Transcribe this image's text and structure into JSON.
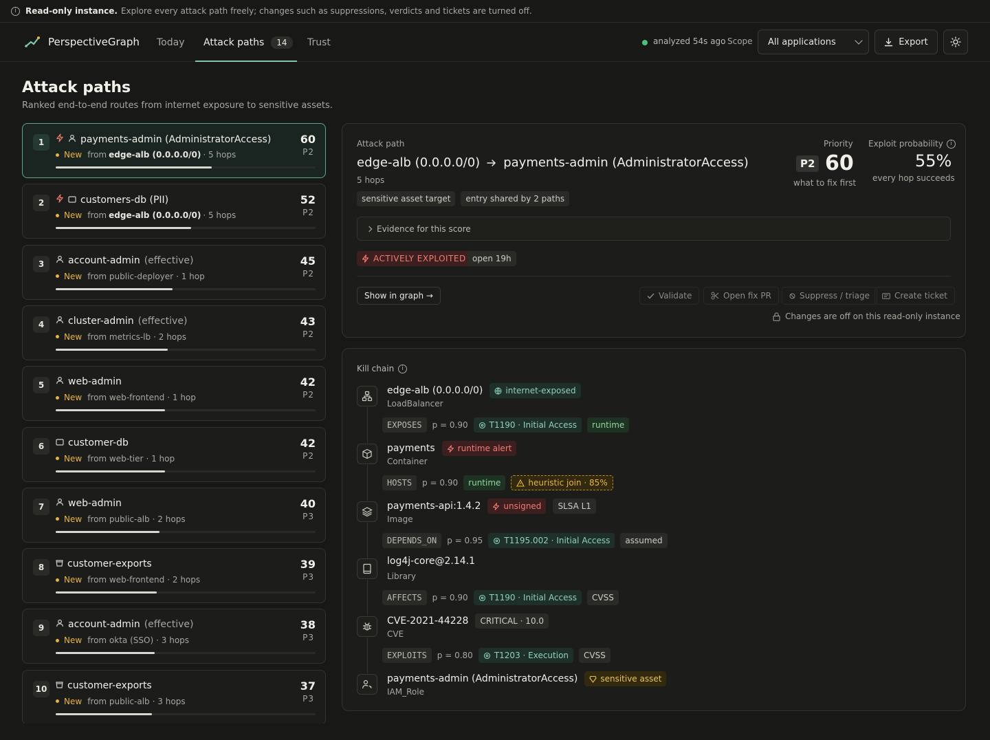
{
  "banner": {
    "bold": "Read-only instance.",
    "text": "Explore every attack path freely; changes such as suppressions, verdicts and tickets are turned off."
  },
  "header": {
    "brand": "PerspectiveGraph",
    "nav": [
      {
        "label": "Today"
      },
      {
        "label": "Attack paths",
        "count": "14"
      },
      {
        "label": "Trust"
      }
    ],
    "status": "analyzed 54s ago",
    "scope_label": "Scope",
    "scope_value": "All applications",
    "export_label": "Export"
  },
  "page": {
    "title": "Attack paths",
    "subtitle": "Ranked end-to-end routes from internet exposure to sensitive assets."
  },
  "paths": [
    {
      "rank": "1",
      "icons": [
        "bolt",
        "user"
      ],
      "name": "payments-admin (AdministratorAccess)",
      "suffix": "",
      "new": "New",
      "from": "from",
      "source": "edge-alb (0.0.0.0/0)",
      "source_bold": true,
      "hops": "· 5 hops",
      "score": "60",
      "prio": "P2",
      "progress": 0.6
    },
    {
      "rank": "2",
      "icons": [
        "bolt",
        "db"
      ],
      "name": "customers-db (PII)",
      "suffix": "",
      "new": "New",
      "from": "from",
      "source": "edge-alb (0.0.0.0/0)",
      "source_bold": true,
      "hops": "· 5 hops",
      "score": "52",
      "prio": "P2",
      "progress": 0.52
    },
    {
      "rank": "3",
      "icons": [
        "user"
      ],
      "name": "account-admin",
      "suffix": "(effective)",
      "new": "New",
      "from": "from public-deployer",
      "source": "",
      "source_bold": false,
      "hops": "· 1 hop",
      "score": "45",
      "prio": "P2",
      "progress": 0.45
    },
    {
      "rank": "4",
      "icons": [
        "user"
      ],
      "name": "cluster-admin",
      "suffix": "(effective)",
      "new": "New",
      "from": "from metrics-lb",
      "source": "",
      "source_bold": false,
      "hops": "· 2 hops",
      "score": "43",
      "prio": "P2",
      "progress": 0.43
    },
    {
      "rank": "5",
      "icons": [
        "user"
      ],
      "name": "web-admin",
      "suffix": "",
      "new": "New",
      "from": "from web-frontend",
      "source": "",
      "source_bold": false,
      "hops": "· 1 hop",
      "score": "42",
      "prio": "P2",
      "progress": 0.42
    },
    {
      "rank": "6",
      "icons": [
        "db"
      ],
      "name": "customer-db",
      "suffix": "",
      "new": "New",
      "from": "from web-tier",
      "source": "",
      "source_bold": false,
      "hops": "· 1 hop",
      "score": "42",
      "prio": "P2",
      "progress": 0.42
    },
    {
      "rank": "7",
      "icons": [
        "user"
      ],
      "name": "web-admin",
      "suffix": "",
      "new": "New",
      "from": "from public-alb",
      "source": "",
      "source_bold": false,
      "hops": "· 2 hops",
      "score": "40",
      "prio": "P3",
      "progress": 0.4
    },
    {
      "rank": "8",
      "icons": [
        "bucket"
      ],
      "name": "customer-exports",
      "suffix": "",
      "new": "New",
      "from": "from web-frontend",
      "source": "",
      "source_bold": false,
      "hops": "· 2 hops",
      "score": "39",
      "prio": "P3",
      "progress": 0.39
    },
    {
      "rank": "9",
      "icons": [
        "user"
      ],
      "name": "account-admin",
      "suffix": "(effective)",
      "new": "New",
      "from": "from okta (SSO)",
      "source": "",
      "source_bold": false,
      "hops": "· 3 hops",
      "score": "38",
      "prio": "P3",
      "progress": 0.38
    },
    {
      "rank": "10",
      "icons": [
        "bucket"
      ],
      "name": "customer-exports",
      "suffix": "",
      "new": "New",
      "from": "from public-alb",
      "source": "",
      "source_bold": false,
      "hops": "· 3 hops",
      "score": "37",
      "prio": "P3",
      "progress": 0.37
    }
  ],
  "detail": {
    "label": "Attack path",
    "source": "edge-alb (0.0.0.0/0)",
    "target": "payments-admin (AdministratorAccess)",
    "hops": "5 hops",
    "chips": [
      "sensitive asset target",
      "entry shared by 2 paths"
    ],
    "priority_label": "Priority",
    "priority_badge": "P2",
    "priority_score": "60",
    "priority_sub": "what to fix first",
    "exploit_label": "Exploit probability",
    "exploit_value": "55%",
    "exploit_sub": "every hop succeeds",
    "evidence": "Evidence for this score",
    "exploited": "ACTIVELY EXPLOITED",
    "open": "open 19h",
    "show_graph": "Show in graph →",
    "validate": "Validate",
    "open_fix": "Open fix PR",
    "suppress": "Suppress / triage",
    "ticket": "Create ticket",
    "readonly_note": "Changes are off on this read-only instance"
  },
  "killchain": {
    "label": "Kill chain",
    "nodes": [
      {
        "name": "edge-alb (0.0.0.0/0)",
        "type": "LoadBalancer",
        "icon": "network-icon",
        "tags": [
          {
            "kind": "inet",
            "text": "internet-exposed"
          }
        ]
      },
      {
        "name": "payments",
        "type": "Container",
        "icon": "cube-icon",
        "tags": [
          {
            "kind": "red",
            "text": "runtime alert"
          }
        ]
      },
      {
        "name": "payments-api:1.4.2",
        "type": "Image",
        "icon": "layers-icon",
        "tags": [
          {
            "kind": "red",
            "text": "unsigned"
          },
          {
            "kind": "grey",
            "text": "SLSA L1"
          }
        ]
      },
      {
        "name": "log4j-core@2.14.1",
        "type": "Library",
        "icon": "book-icon",
        "tags": []
      },
      {
        "name": "CVE-2021-44228",
        "type": "CVE",
        "icon": "bug-icon",
        "tags": [
          {
            "kind": "grey",
            "text": "CRITICAL · 10.0"
          }
        ]
      },
      {
        "name": "payments-admin (AdministratorAccess)",
        "type": "IAM_Role",
        "icon": "user-key-icon",
        "tags": [
          {
            "kind": "yellow",
            "text": "sensitive asset"
          }
        ]
      }
    ],
    "edges": [
      {
        "rel": "EXPOSES",
        "p": "p = 0.90",
        "mitre": "T1190 · Initial Access",
        "tags": [
          {
            "kind": "green",
            "text": "runtime"
          }
        ]
      },
      {
        "rel": "HOSTS",
        "p": "p = 0.90",
        "mitre": "",
        "tags": [
          {
            "kind": "green",
            "text": "runtime"
          },
          {
            "kind": "warn",
            "text": "heuristic join · 85%"
          }
        ]
      },
      {
        "rel": "DEPENDS_ON",
        "p": "p = 0.95",
        "mitre": "T1195.002 · Initial Access",
        "tags": [
          {
            "kind": "grey",
            "text": "assumed"
          }
        ]
      },
      {
        "rel": "AFFECTS",
        "p": "p = 0.90",
        "mitre": "T1190 · Initial Access",
        "tags": [
          {
            "kind": "grey",
            "text": "CVSS"
          }
        ]
      },
      {
        "rel": "EXPLOITS",
        "p": "p = 0.80",
        "mitre": "T1203 · Execution",
        "tags": [
          {
            "kind": "grey",
            "text": "CVSS"
          }
        ]
      }
    ]
  },
  "colors": {
    "accent": "#7fc7b3",
    "new": "#e8b445",
    "danger": "#f07c72",
    "status_ok": "#4ec27a"
  }
}
